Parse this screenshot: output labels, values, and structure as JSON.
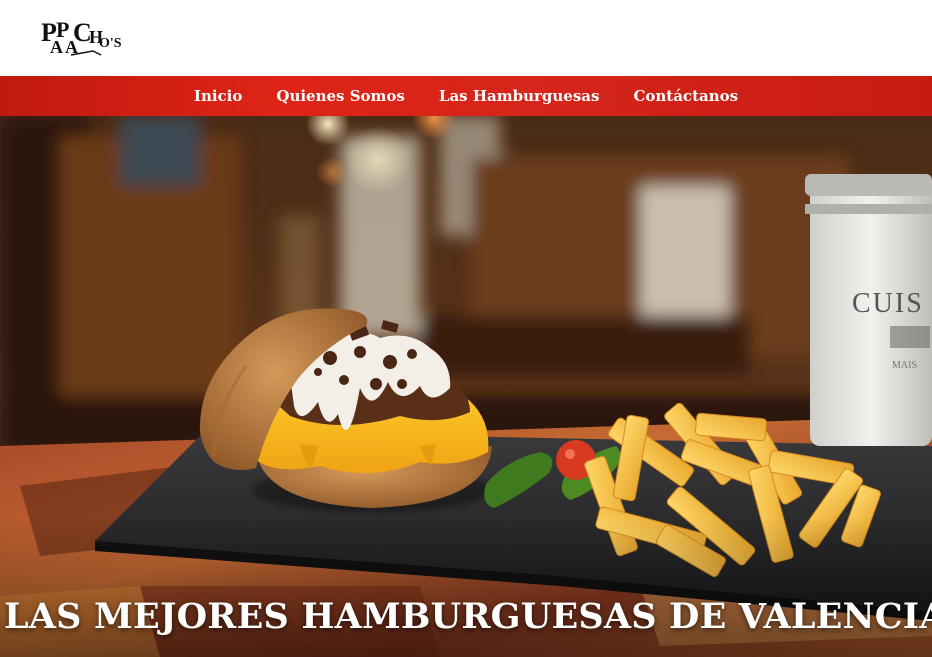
{
  "logo": {
    "text": "PAPACHOS",
    "alt": "Papacho's"
  },
  "nav": {
    "items": [
      {
        "label": "Inicio"
      },
      {
        "label": "Quienes Somos"
      },
      {
        "label": "Las Hamburguesas"
      },
      {
        "label": "Contáctanos"
      }
    ]
  },
  "hero": {
    "headline": "LAS MEJORES HAMBURGUESAS DE VALENCIA",
    "jar_text": "CUIS",
    "image_name": "burger-with-fries-photo"
  },
  "colors": {
    "nav_red": "#d5251a",
    "text_white": "#ffffff"
  }
}
